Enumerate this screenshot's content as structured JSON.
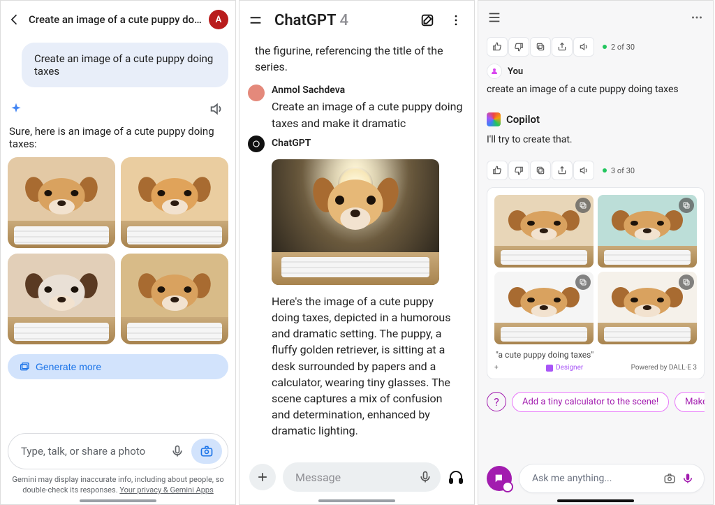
{
  "gemini": {
    "title": "Create an image of a cute puppy doin...",
    "avatar_initial": "A",
    "user_prompt": "Create an image of a cute puppy doing taxes",
    "response_intro": "Sure, here is an image of a cute puppy doing taxes:",
    "generate_more": "Generate more",
    "input_placeholder": "Type, talk, or share a photo",
    "disclaimer_pre": "Gemini may display inaccurate info, including about people, so double-check its responses. ",
    "disclaimer_link": "Your privacy & Gemini Apps",
    "images": [
      "puppy-1",
      "puppy-2",
      "puppy-3",
      "puppy-4"
    ]
  },
  "chatgpt": {
    "brand": "ChatGPT",
    "version": "4",
    "partial_prev": "the figurine, referencing the title of the series.",
    "user_name": "Anmol Sachdeva",
    "user_prompt": "Create an image of a cute puppy doing taxes and make it dramatic",
    "assistant_name": "ChatGPT",
    "assistant_text": "Here's the image of a cute puppy doing taxes, depicted in a humorous and dramatic setting. The puppy, a fluffy golden retriever, is sitting at a desk surrounded by papers and a calculator, wearing tiny glasses. The scene captures a mix of confusion and determination, enhanced by dramatic lighting.",
    "input_placeholder": "Message"
  },
  "copilot": {
    "counter1": "2 of 30",
    "counter2": "3 of 30",
    "you": "You",
    "user_prompt": "create an image of a cute puppy doing taxes",
    "brand": "Copilot",
    "assistant_text": "I'll try to create that.",
    "caption": "\"a cute puppy doing taxes\"",
    "designer": "Designer",
    "powered": "Powered by DALL·E 3",
    "suggestions": [
      "Add a tiny calculator to the scene!",
      "Make the puppy w"
    ],
    "input_placeholder": "Ask me anything..."
  }
}
